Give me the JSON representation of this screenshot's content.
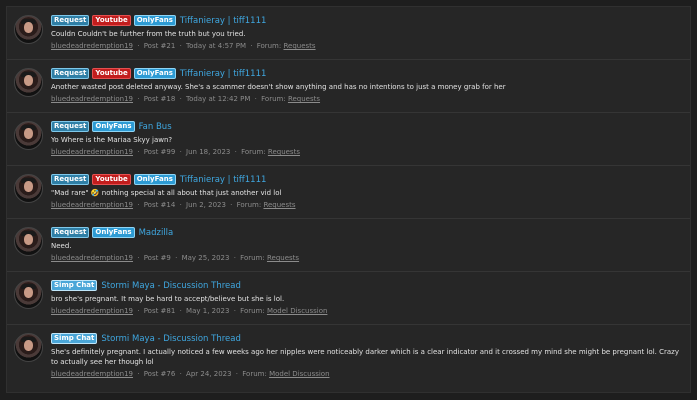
{
  "results": [
    {
      "tags": [
        "Request",
        "Youtube",
        "OnlyFans"
      ],
      "title": "Tiffanieray | tiff1111",
      "snippet": "Couldn Couldn't be further from the truth but you tried.",
      "author": "bluedeadredemption19",
      "post": "Post #21",
      "date": "Today at 4:57 PM",
      "forum_label": "Forum:",
      "forum": "Requests"
    },
    {
      "tags": [
        "Request",
        "Youtube",
        "OnlyFans"
      ],
      "title": "Tiffanieray | tiff1111",
      "snippet": "Another wasted post deleted anyway. She's a scammer doesn't show anything and has no intentions to just a money grab for her",
      "author": "bluedeadredemption19",
      "post": "Post #18",
      "date": "Today at 12:42 PM",
      "forum_label": "Forum:",
      "forum": "Requests"
    },
    {
      "tags": [
        "Request",
        "OnlyFans"
      ],
      "title": "Fan Bus",
      "snippet": "Yo Where is the Mariaa Skyy jawn?",
      "author": "bluedeadredemption19",
      "post": "Post #99",
      "date": "Jun 18, 2023",
      "forum_label": "Forum:",
      "forum": "Requests"
    },
    {
      "tags": [
        "Request",
        "Youtube",
        "OnlyFans"
      ],
      "title": "Tiffanieray | tiff1111",
      "snippet": "\"Mad rare\" 🤣 nothing special at all about that just another vid lol",
      "author": "bluedeadredemption19",
      "post": "Post #14",
      "date": "Jun 2, 2023",
      "forum_label": "Forum:",
      "forum": "Requests"
    },
    {
      "tags": [
        "Request",
        "OnlyFans"
      ],
      "title": "Madzilla",
      "snippet": "Need.",
      "author": "bluedeadredemption19",
      "post": "Post #9",
      "date": "May 25, 2023",
      "forum_label": "Forum:",
      "forum": "Requests"
    },
    {
      "tags": [
        "Simp Chat"
      ],
      "title": "Stormi Maya - Discussion Thread",
      "snippet": "bro she's pregnant. It may be hard to accept/believe but she is lol.",
      "author": "bluedeadredemption19",
      "post": "Post #81",
      "date": "May 1, 2023",
      "forum_label": "Forum:",
      "forum": "Model Discussion"
    },
    {
      "tags": [
        "Simp Chat"
      ],
      "title": "Stormi Maya - Discussion Thread",
      "snippet": "She's definitely pregnant. I actually noticed a few weeks ago her nipples were noticeably darker which is a clear indicator and it crossed my mind she might be pregnant lol. Crazy to actually see her though lol",
      "author": "bluedeadredemption19",
      "post": "Post #76",
      "date": "Apr 24, 2023",
      "forum_label": "Forum:",
      "forum": "Model Discussion"
    }
  ],
  "separator": "·"
}
